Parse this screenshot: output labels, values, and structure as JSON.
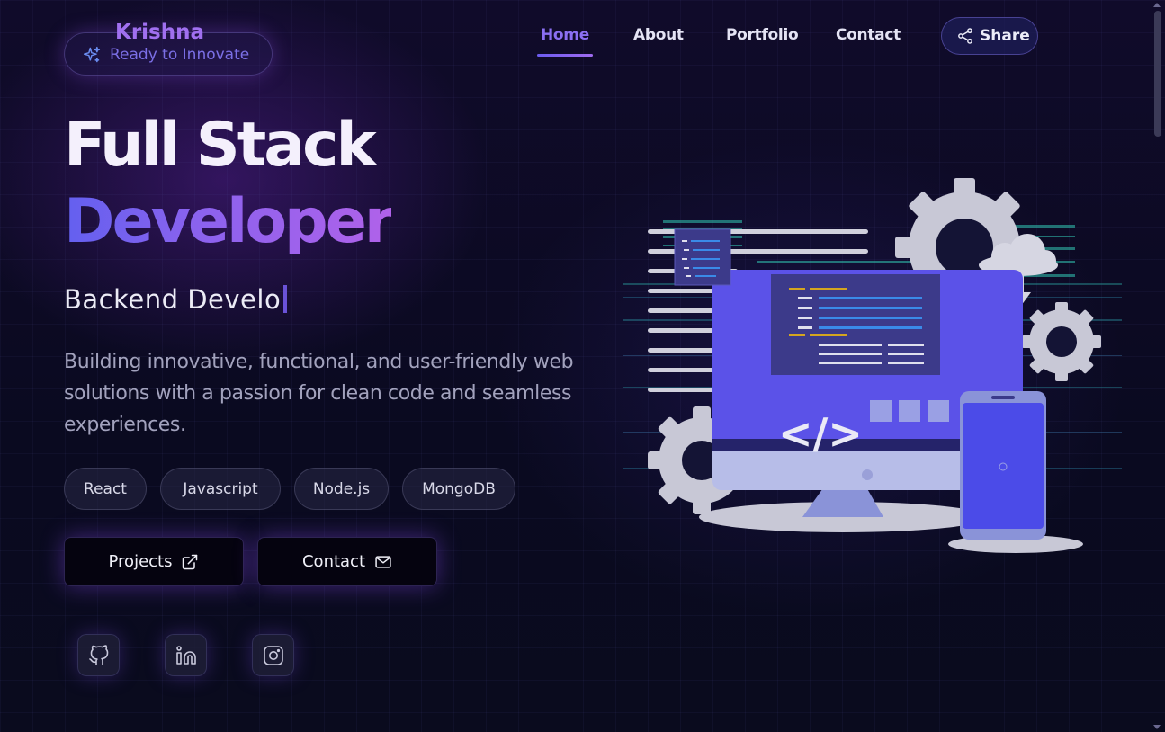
{
  "brand": {
    "name": "Krishna",
    "tagline": "Ready to Innovate",
    "icon": "sparkles-icon"
  },
  "nav": {
    "items": [
      {
        "label": "Home",
        "active": true
      },
      {
        "label": "About"
      },
      {
        "label": "Portfolio"
      },
      {
        "label": "Contact"
      }
    ],
    "share_label": "Share",
    "share_icon": "share-icon"
  },
  "hero": {
    "title_line1": "Full Stack",
    "title_line2": "Developer",
    "typing_text": "Backend Develo",
    "description": "Building innovative, functional, and user-friendly web solutions with a passion for clean code and seamless experiences."
  },
  "tags": [
    "React",
    "Javascript",
    "Node.js",
    "MongoDB"
  ],
  "buttons": {
    "projects_label": "Projects",
    "projects_icon": "external-link-icon",
    "contact_label": "Contact",
    "contact_icon": "mail-icon"
  },
  "socials": [
    {
      "name": "github",
      "icon": "github-icon"
    },
    {
      "name": "linkedin",
      "icon": "linkedin-icon"
    },
    {
      "name": "instagram",
      "icon": "instagram-icon"
    }
  ],
  "illustration": {
    "code_symbol": "</>"
  },
  "colors": {
    "accent": "#8b6ff2",
    "accent_pink": "#b062ea",
    "background": "#0b0a1f",
    "muted_text": "#a2a2bd"
  }
}
